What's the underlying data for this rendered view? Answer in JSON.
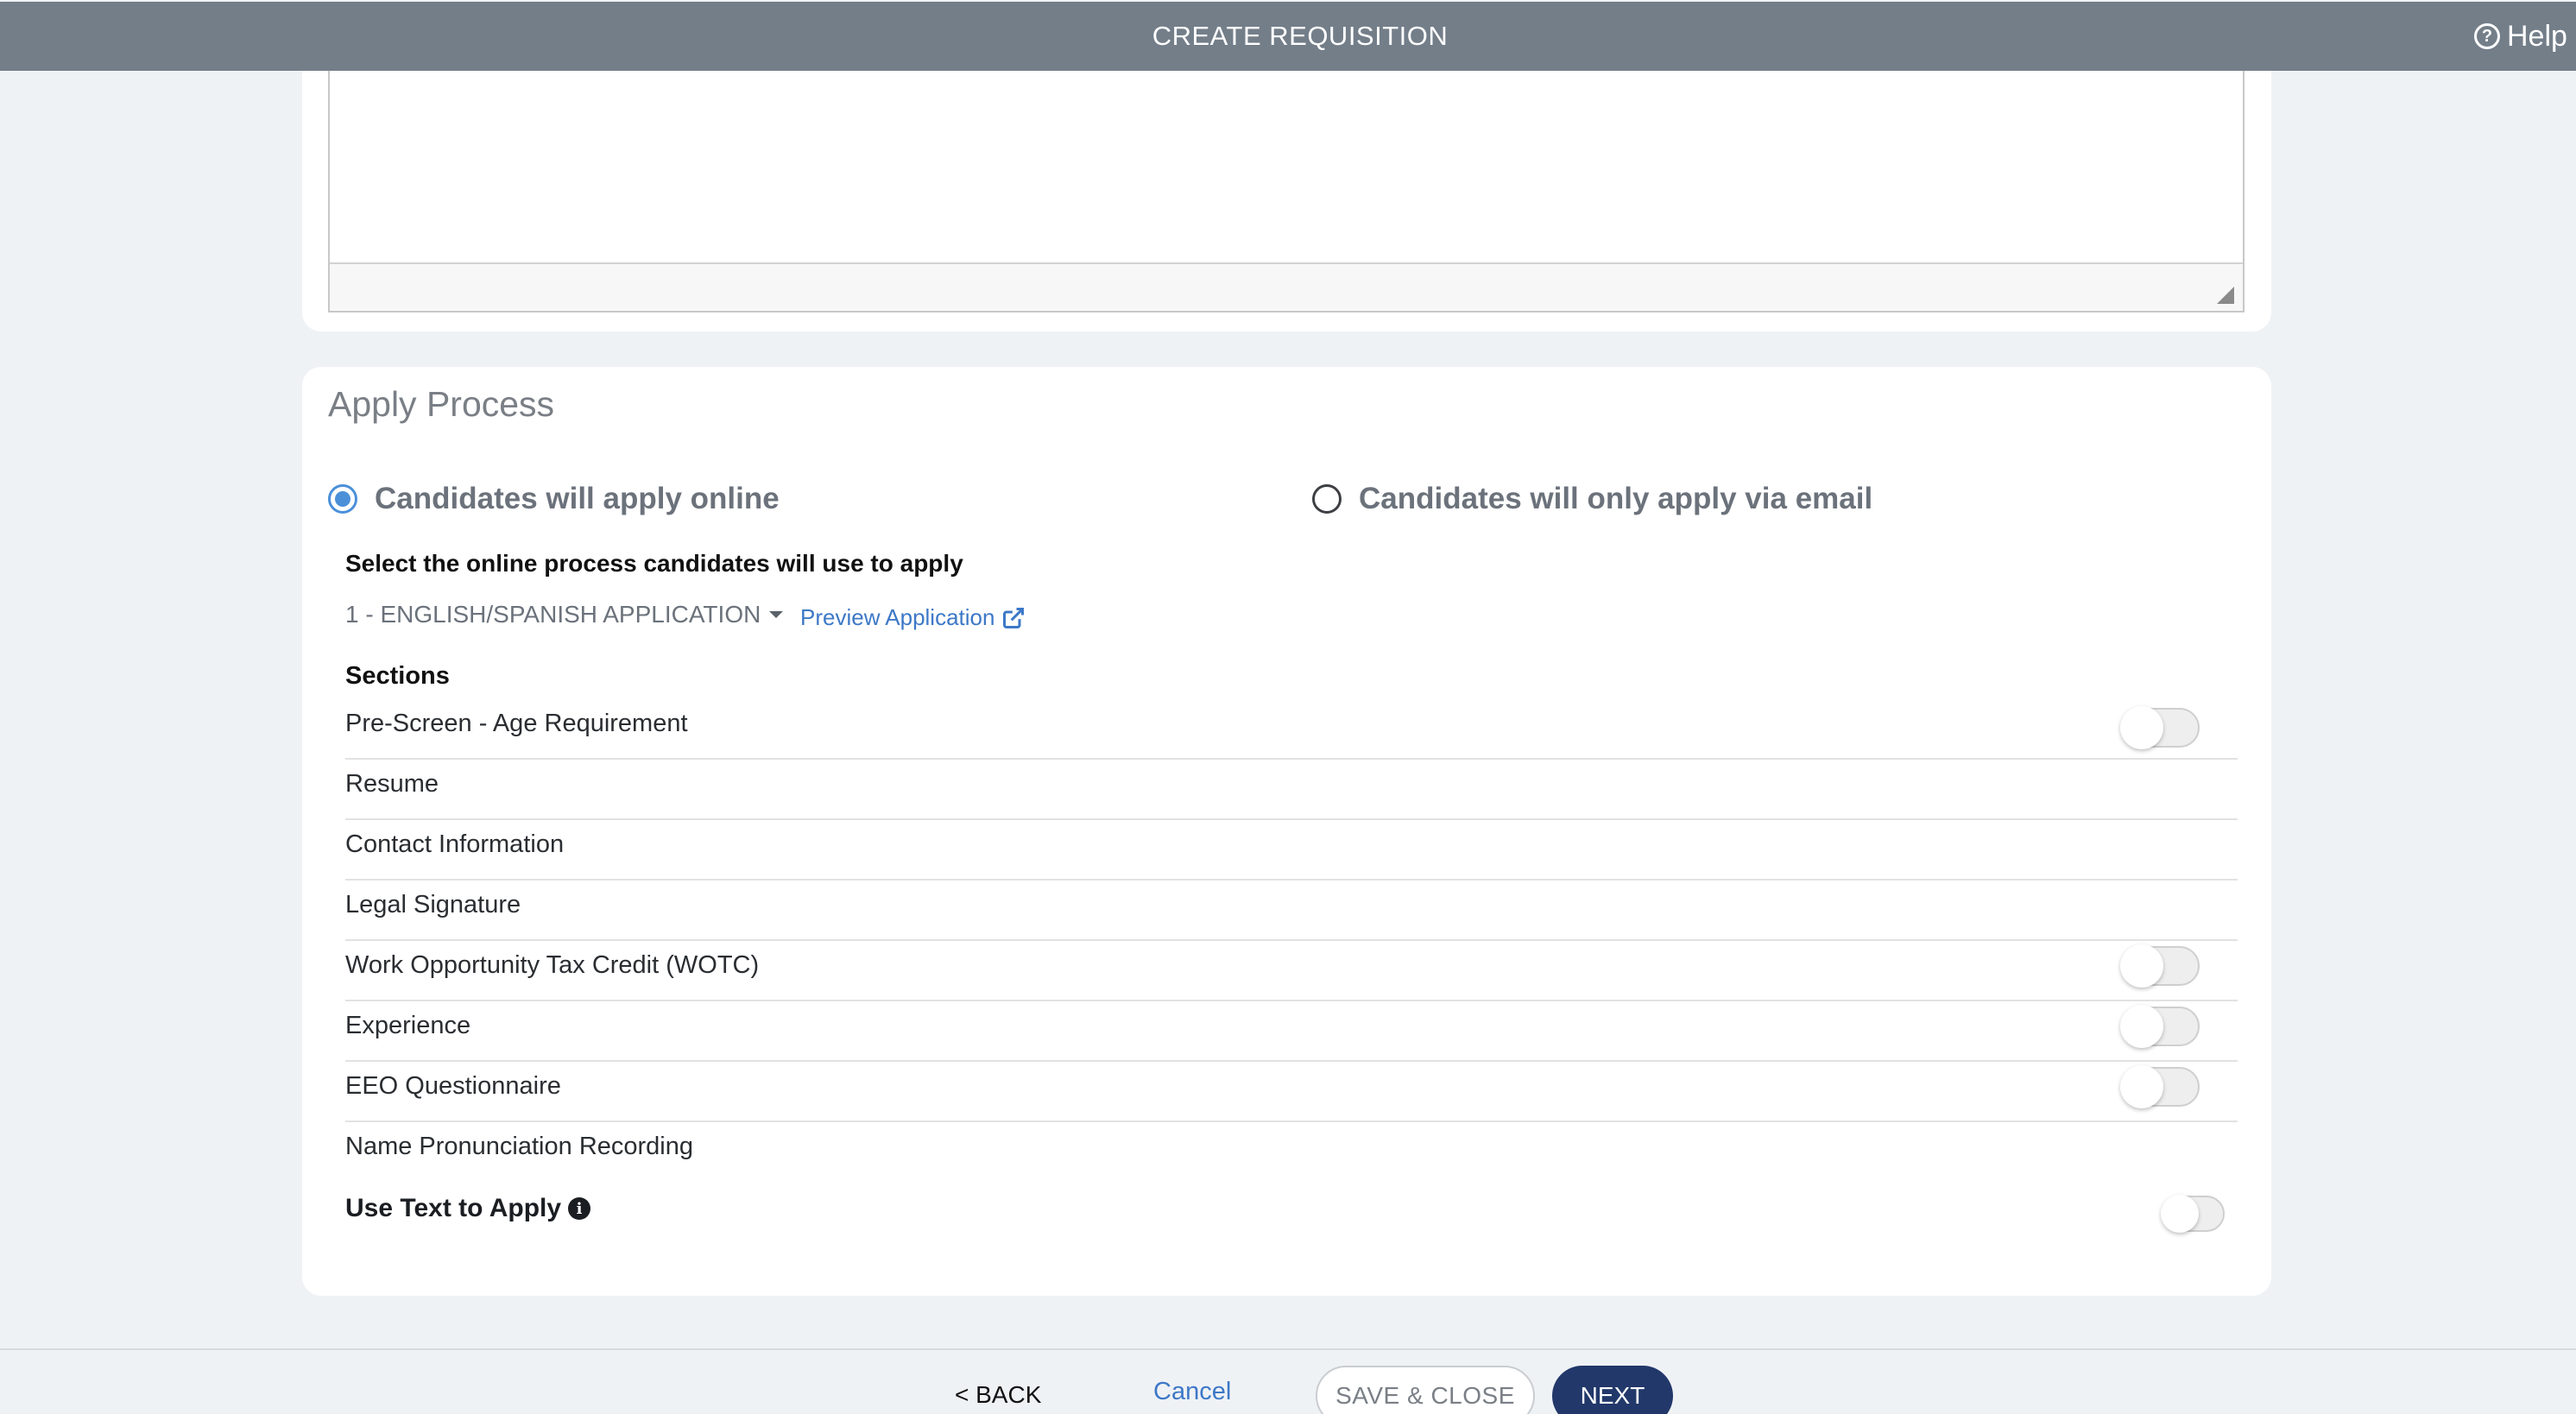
{
  "header": {
    "title": "CREATE REQUISITION",
    "help_label": "Help",
    "help_icon": "question-circle-icon"
  },
  "apply_process": {
    "title": "Apply Process",
    "options": [
      {
        "label": "Candidates will apply online",
        "selected": true
      },
      {
        "label": "Candidates will only apply via email",
        "selected": false
      }
    ],
    "select_label": "Select the online process candidates will use to apply",
    "application_value": "1 - ENGLISH/SPANISH APPLICATION",
    "preview_label": "Preview Application",
    "sections_title": "Sections",
    "sections": [
      {
        "label": "Pre-Screen - Age Requirement",
        "has_toggle": true,
        "enabled": false
      },
      {
        "label": "Resume",
        "has_toggle": false
      },
      {
        "label": "Contact Information",
        "has_toggle": false
      },
      {
        "label": "Legal Signature",
        "has_toggle": false
      },
      {
        "label": "Work Opportunity Tax Credit (WOTC)",
        "has_toggle": true,
        "enabled": false
      },
      {
        "label": "Experience",
        "has_toggle": true,
        "enabled": false
      },
      {
        "label": "EEO Questionnaire",
        "has_toggle": true,
        "enabled": false
      },
      {
        "label": "Name Pronunciation Recording",
        "has_toggle": false
      }
    ],
    "text_to_apply_label": "Use Text to Apply",
    "text_to_apply_enabled": false
  },
  "footer": {
    "back_label": "< BACK",
    "cancel_label": "Cancel",
    "save_close_label": "SAVE & CLOSE",
    "next_label": "NEXT"
  },
  "colors": {
    "header_bg": "#737e89",
    "accent_blue": "#4a90d9",
    "link_blue": "#3d78c7",
    "next_button_bg": "#22386a"
  }
}
